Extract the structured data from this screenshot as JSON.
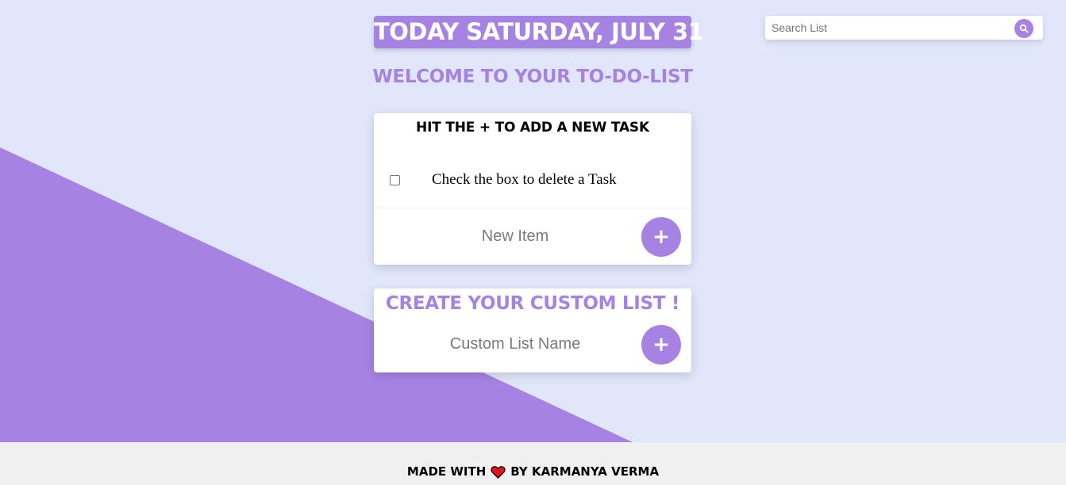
{
  "header": {
    "date_heading": "TODAY SATURDAY, JULY 31",
    "welcome": "WELCOME TO YOUR TO-DO-LIST"
  },
  "search": {
    "placeholder": "Search List",
    "icon": "search-icon"
  },
  "todo_card": {
    "title": "HIT THE + TO ADD A NEW TASK",
    "items": [
      {
        "label": "Check the box to delete a Task",
        "checked": false
      }
    ],
    "new_item_placeholder": "New Item",
    "add_button_label": "+"
  },
  "custom_list_card": {
    "title": "CREATE YOUR CUSTOM LIST !",
    "name_placeholder": "Custom List Name",
    "add_button_label": "+"
  },
  "footer": {
    "prefix": "MADE WITH",
    "icon": "heart-icon",
    "suffix": "BY KARMANYA VERMA"
  },
  "colors": {
    "accent": "#a683e3",
    "background": "#e1e6fb",
    "footer_bg": "#f0f0f0",
    "heart": "#e0161c"
  }
}
